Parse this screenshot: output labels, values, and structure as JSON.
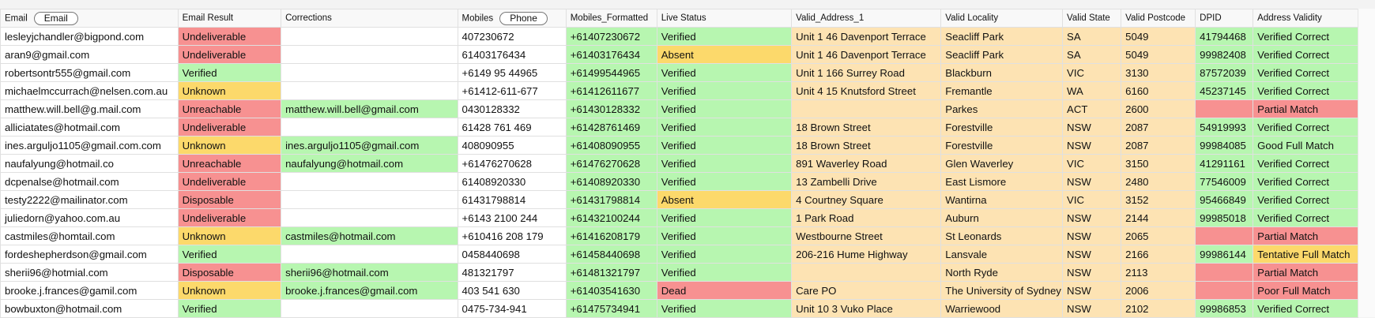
{
  "columns": [
    {
      "label": "Email",
      "button": "Email",
      "width": 203
    },
    {
      "label": "Email Result",
      "width": 118
    },
    {
      "label": "Corrections",
      "width": 202
    },
    {
      "label": "Mobiles",
      "button": "Phone",
      "width": 124
    },
    {
      "label": "Mobiles_Formatted",
      "width": 104
    },
    {
      "label": "Live Status",
      "width": 154
    },
    {
      "label": "Valid_Address_1",
      "width": 171
    },
    {
      "label": "Valid Locality",
      "width": 139
    },
    {
      "label": "Valid State",
      "width": 67
    },
    {
      "label": "Valid Postcode",
      "width": 85
    },
    {
      "label": "DPID",
      "width": 66
    },
    {
      "label": "Address Validity",
      "width": 120
    }
  ],
  "colors": {
    "green": "#b7f6b0",
    "red": "#f79191",
    "yellow": "#fcd96b",
    "peach": "#fde3b3"
  },
  "rows": [
    {
      "email": "lesleyjchandler@bigpond.com",
      "result": "Undeliverable",
      "correction": "",
      "mobile": "407230672",
      "formatted": "+61407230672",
      "live": "Verified",
      "address": "Unit 1 46 Davenport Terrace",
      "locality": "Seacliff Park",
      "state": "SA",
      "postcode": "5049",
      "dpid": "41794468",
      "validity": "Verified Correct"
    },
    {
      "email": "aran9@gmail.com",
      "result": "Undeliverable",
      "correction": "",
      "mobile": "61403176434",
      "formatted": "+61403176434",
      "live": "Absent",
      "address": "Unit 1 46 Davenport Terrace",
      "locality": "Seacliff Park",
      "state": "SA",
      "postcode": "5049",
      "dpid": "99982408",
      "validity": "Verified Correct"
    },
    {
      "email": "robertsontr555@gmail.com",
      "result": "Verified",
      "correction": "",
      "mobile": "+6149 95 44965",
      "formatted": "+61499544965",
      "live": "Verified",
      "address": "Unit 1 166 Surrey Road",
      "locality": "Blackburn",
      "state": "VIC",
      "postcode": "3130",
      "dpid": "87572039",
      "validity": "Verified Correct"
    },
    {
      "email": "michaelmccurrach@nelsen.com.au",
      "result": "Unknown",
      "correction": "",
      "mobile": "+61412-611-677",
      "formatted": "+61412611677",
      "live": "Verified",
      "address": "Unit 4 15 Knutsford Street",
      "locality": "Fremantle",
      "state": "WA",
      "postcode": "6160",
      "dpid": "45237145",
      "validity": "Verified Correct"
    },
    {
      "email": "matthew.will.bell@g.mail.com",
      "result": "Unreachable",
      "correction": "matthew.will.bell@gmail.com",
      "mobile": "0430128332",
      "formatted": "+61430128332",
      "live": "Verified",
      "address": "",
      "locality": "Parkes",
      "state": "ACT",
      "postcode": "2600",
      "dpid": "",
      "validity": "Partial Match"
    },
    {
      "email": "alliciatates@hotmail.com",
      "result": "Undeliverable",
      "correction": "",
      "mobile": "61428 761 469",
      "formatted": "+61428761469",
      "live": "Verified",
      "address": "18 Brown Street",
      "locality": "Forestville",
      "state": "NSW",
      "postcode": "2087",
      "dpid": "54919993",
      "validity": "Verified Correct"
    },
    {
      "email": "ines.arguljo1105@gmail.com.com",
      "result": "Unknown",
      "correction": "ines.arguljo1105@gmail.com",
      "mobile": "408090955",
      "formatted": "+61408090955",
      "live": "Verified",
      "address": "18 Brown Street",
      "locality": "Forestville",
      "state": "NSW",
      "postcode": "2087",
      "dpid": "99984085",
      "validity": "Good Full Match"
    },
    {
      "email": "naufalyung@hotmail.co",
      "result": "Unreachable",
      "correction": "naufalyung@hotmail.com",
      "mobile": "+61476270628",
      "formatted": "+61476270628",
      "live": "Verified",
      "address": "891 Waverley Road",
      "locality": "Glen Waverley",
      "state": "VIC",
      "postcode": "3150",
      "dpid": "41291161",
      "validity": "Verified Correct"
    },
    {
      "email": "dcpenalse@hotmail.com",
      "result": "Undeliverable",
      "correction": "",
      "mobile": "61408920330",
      "formatted": "+61408920330",
      "live": "Verified",
      "address": "13 Zambelli Drive",
      "locality": "East Lismore",
      "state": "NSW",
      "postcode": "2480",
      "dpid": "77546009",
      "validity": "Verified Correct"
    },
    {
      "email": "testy2222@mailinator.com",
      "result": "Disposable",
      "correction": "",
      "mobile": "61431798814",
      "formatted": "+61431798814",
      "live": "Absent",
      "address": "4 Courtney Square",
      "locality": "Wantirna",
      "state": "VIC",
      "postcode": "3152",
      "dpid": "95466849",
      "validity": "Verified Correct"
    },
    {
      "email": "juliedorn@yahoo.com.au",
      "result": "Undeliverable",
      "correction": "",
      "mobile": "+6143 2100 244",
      "formatted": "+61432100244",
      "live": "Verified",
      "address": "1 Park Road",
      "locality": "Auburn",
      "state": "NSW",
      "postcode": "2144",
      "dpid": "99985018",
      "validity": "Verified Correct"
    },
    {
      "email": "castmiles@homtail.com",
      "result": "Unknown",
      "correction": "castmiles@hotmail.com",
      "mobile": "+610416 208 179",
      "formatted": "+61416208179",
      "live": "Verified",
      "address": "Westbourne Street",
      "locality": "St Leonards",
      "state": "NSW",
      "postcode": "2065",
      "dpid": "",
      "validity": "Partial Match"
    },
    {
      "email": "fordeshepherdson@gmail.com",
      "result": "Verified",
      "correction": "",
      "mobile": "0458440698",
      "formatted": "+61458440698",
      "live": "Verified",
      "address": "206-216 Hume Highway",
      "locality": "Lansvale",
      "state": "NSW",
      "postcode": "2166",
      "dpid": "99986144",
      "validity": "Tentative Full Match"
    },
    {
      "email": "sherii96@hotmial.com",
      "result": "Disposable",
      "correction": "sherii96@hotmail.com",
      "mobile": "481321797",
      "formatted": "+61481321797",
      "live": "Verified",
      "address": "",
      "locality": "North Ryde",
      "state": "NSW",
      "postcode": "2113",
      "dpid": "",
      "validity": "Partial Match"
    },
    {
      "email": "brooke.j.frances@gamil.com",
      "result": "Unknown",
      "correction": "brooke.j.frances@gmail.com",
      "mobile": "403 541 630",
      "formatted": "+61403541630",
      "live": "Dead",
      "address": "Care PO",
      "locality": "The University of Sydney",
      "state": "NSW",
      "postcode": "2006",
      "dpid": "",
      "validity": "Poor Full Match"
    },
    {
      "email": "bowbuxton@hotmail.com",
      "result": "Verified",
      "correction": "",
      "mobile": "0475-734-941",
      "formatted": "+61475734941",
      "live": "Verified",
      "address": "Unit 10 3 Vuko Place",
      "locality": "Warriewood",
      "state": "NSW",
      "postcode": "2102",
      "dpid": "99986853",
      "validity": "Verified Correct"
    }
  ]
}
